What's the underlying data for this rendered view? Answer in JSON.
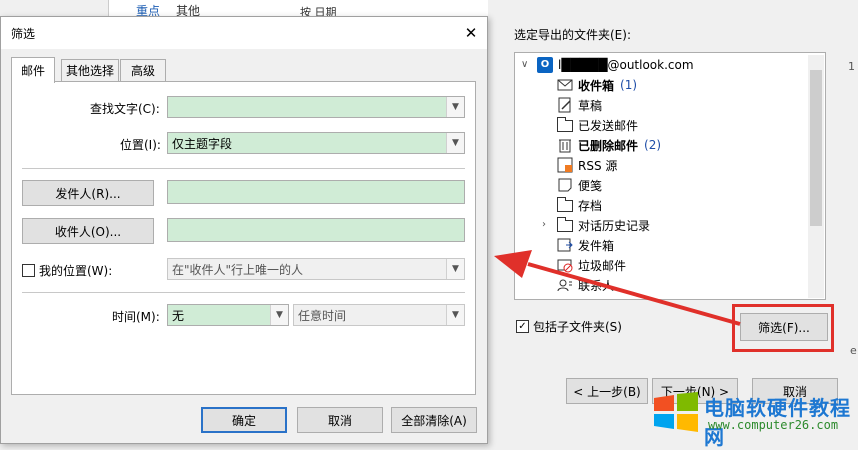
{
  "background": {
    "top_tabs": [
      "重点",
      "其他",
      "按 日期"
    ],
    "folder_label": "选定导出的文件夹(E):",
    "account": "l█████@outlook.com",
    "folders": [
      {
        "name": "收件箱",
        "count": "(1)",
        "bold": true
      },
      {
        "name": "草稿",
        "count": ""
      },
      {
        "name": "已发送邮件",
        "count": ""
      },
      {
        "name": "已删除邮件",
        "count": "(2)",
        "bold": true
      },
      {
        "name": "RSS 源",
        "count": ""
      },
      {
        "name": "便笺",
        "count": ""
      },
      {
        "name": "存档",
        "count": ""
      },
      {
        "name": "对话历史记录",
        "count": ""
      },
      {
        "name": "发件箱",
        "count": ""
      },
      {
        "name": "垃圾邮件",
        "count": ""
      },
      {
        "name": "联系人",
        "count": ""
      }
    ],
    "include_subfolders": "包括子文件夹(S)",
    "filter_button": "筛选(F)...",
    "prev_button": "< 上一步(B)",
    "next_button": "下一步(N) >",
    "cancel_button": "取消",
    "edge_a": "1",
    "edge_b": "e"
  },
  "dialog": {
    "title": "筛选",
    "close": "✕",
    "tabs": [
      "邮件",
      "其他选择",
      "高级"
    ],
    "search_text_label": "查找文字(C):",
    "search_text_value": "",
    "location_label": "位置(I):",
    "location_value": "仅主题字段",
    "from_button": "发件人(R)...",
    "from_value": "",
    "to_button": "收件人(O)...",
    "to_value": "",
    "my_location_label": "我的位置(W):",
    "my_location_value": "在\"收件人\"行上唯一的人",
    "time_label": "时间(M):",
    "time_value": "无",
    "time_range_value": "任意时间",
    "ok_button": "确定",
    "cancel_button": "取消",
    "clear_button": "全部清除(A)"
  },
  "watermark": {
    "title": "电脑软硬件教程网",
    "url": "www.computer26.com"
  },
  "colors": {
    "highlight": "#e0302a",
    "field_green": "#d0ecd6",
    "accent_blue": "#2a72c8"
  }
}
